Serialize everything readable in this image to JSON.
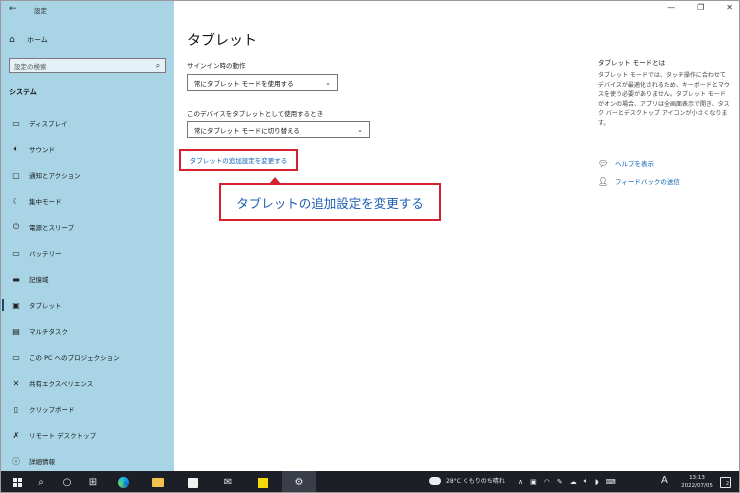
{
  "window": {
    "app_title": "設定",
    "back_icon": "←",
    "controls": {
      "minimize": "—",
      "maximize": "❐",
      "close": "✕"
    }
  },
  "sidebar": {
    "home_label": "ホーム",
    "search_placeholder": "設定の検索",
    "section_label": "システム",
    "items": [
      {
        "label": "ディスプレイ",
        "icon": "monitor-icon",
        "glyph": "▭"
      },
      {
        "label": "サウンド",
        "icon": "speaker-icon",
        "glyph": "🔈︎"
      },
      {
        "label": "通知とアクション",
        "icon": "notification-icon",
        "glyph": "▢"
      },
      {
        "label": "集中モード",
        "icon": "moon-icon",
        "glyph": "☾"
      },
      {
        "label": "電源とスリープ",
        "icon": "power-icon",
        "glyph": "⏻"
      },
      {
        "label": "バッテリー",
        "icon": "battery-icon",
        "glyph": "▭"
      },
      {
        "label": "記憶域",
        "icon": "storage-icon",
        "glyph": "▬"
      },
      {
        "label": "タブレット",
        "icon": "tablet-icon",
        "glyph": "▣",
        "active": true
      },
      {
        "label": "マルチタスク",
        "icon": "multitask-icon",
        "glyph": "▤"
      },
      {
        "label": "この PC へのプロジェクション",
        "icon": "projection-icon",
        "glyph": "▭"
      },
      {
        "label": "共有エクスペリエンス",
        "icon": "share-icon",
        "glyph": "✕"
      },
      {
        "label": "クリップボード",
        "icon": "clipboard-icon",
        "glyph": "▯"
      },
      {
        "label": "リモート デスクトップ",
        "icon": "remote-icon",
        "glyph": "✗"
      },
      {
        "label": "詳細情報",
        "icon": "info-icon",
        "glyph": "ⓘ"
      }
    ]
  },
  "main": {
    "title": "タブレット",
    "signin_label": "サインイン時の動作",
    "signin_value": "常にタブレット モードを使用する",
    "device_label": "このデバイスをタブレットとして使用するとき",
    "device_value": "常にタブレット モードに切り替える",
    "advanced_link": "タブレットの追加設定を変更する",
    "callout": "タブレットの追加設定を変更する"
  },
  "right_panel": {
    "title": "タブレット モードとは",
    "description": "タブレット モードでは、タッチ操作に合わせてデバイスが最適化されるため、キーボードとマウスを使う必要がありません。タブレット モードがオンの場合、アプリは全画面表示で開き、タスク バーとデスクトップ アイコンが小さくなります。",
    "help_label": "ヘルプを表示",
    "feedback_label": "フィードバックの送信"
  },
  "taskbar": {
    "weather": "28°C くもりのち晴れ",
    "ime": "A",
    "time": "13:13",
    "date": "2022/07/05",
    "notification_count": "2"
  },
  "colors": {
    "sidebar_bg": "#a8d4e6",
    "accent_link": "#0a5fb5",
    "highlight_red": "#d5202f",
    "taskbar_bg": "#1c1f26"
  }
}
